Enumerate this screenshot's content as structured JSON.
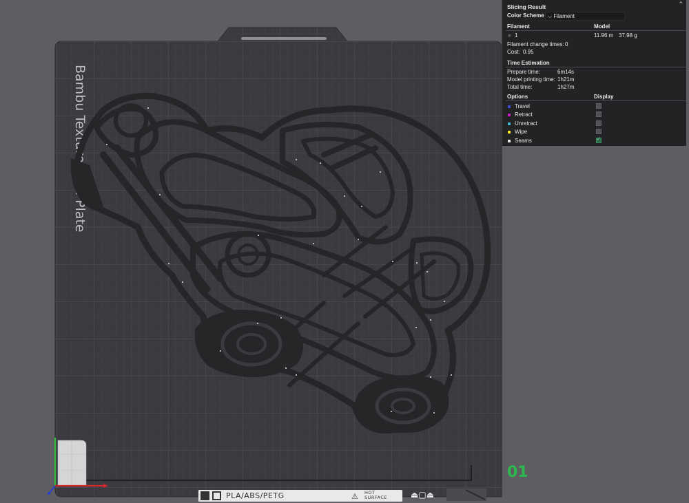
{
  "panel": {
    "title": "Slicing Result",
    "color_scheme_label": "Color Scheme",
    "color_scheme_value": "Filament",
    "filament_header": "Filament",
    "model_header": "Model",
    "filament_row": {
      "index": "1",
      "length": "11.96 m",
      "weight": "37.98 g"
    },
    "filament_change_label": "Filament change times:",
    "filament_change_value": "0",
    "cost_label": "Cost:",
    "cost_value": "0.95",
    "time_header": "Time Estimation",
    "prepare_label": "Prepare time:",
    "prepare_value": "6m14s",
    "model_print_label": "Model printing time:",
    "model_print_value": "1h21m",
    "total_label": "Total time:",
    "total_value": "1h27m",
    "options_header": "Options",
    "display_header": "Display",
    "options": [
      {
        "label": "Travel",
        "color": "#3b4fd1",
        "checked": false
      },
      {
        "label": "Retract",
        "color": "#c41ec4",
        "checked": false
      },
      {
        "label": "Unretract",
        "color": "#3bb7c8",
        "checked": false
      },
      {
        "label": "Wipe",
        "color": "#f2e81c",
        "checked": false
      },
      {
        "label": "Seams",
        "color": "#f0f0f0",
        "checked": true
      }
    ]
  },
  "plate": {
    "side_label": "Bambu Textured PEI Plate",
    "plate_number": "01",
    "material_text": "PLA/ABS/PETG",
    "hot_surface_text": "HOT\nSURFACE",
    "icons": [
      "bambu-logo-icon",
      "plate-outline-icon",
      "warning-icon",
      "eject-icon",
      "plate-icon",
      "eject-icon"
    ]
  }
}
